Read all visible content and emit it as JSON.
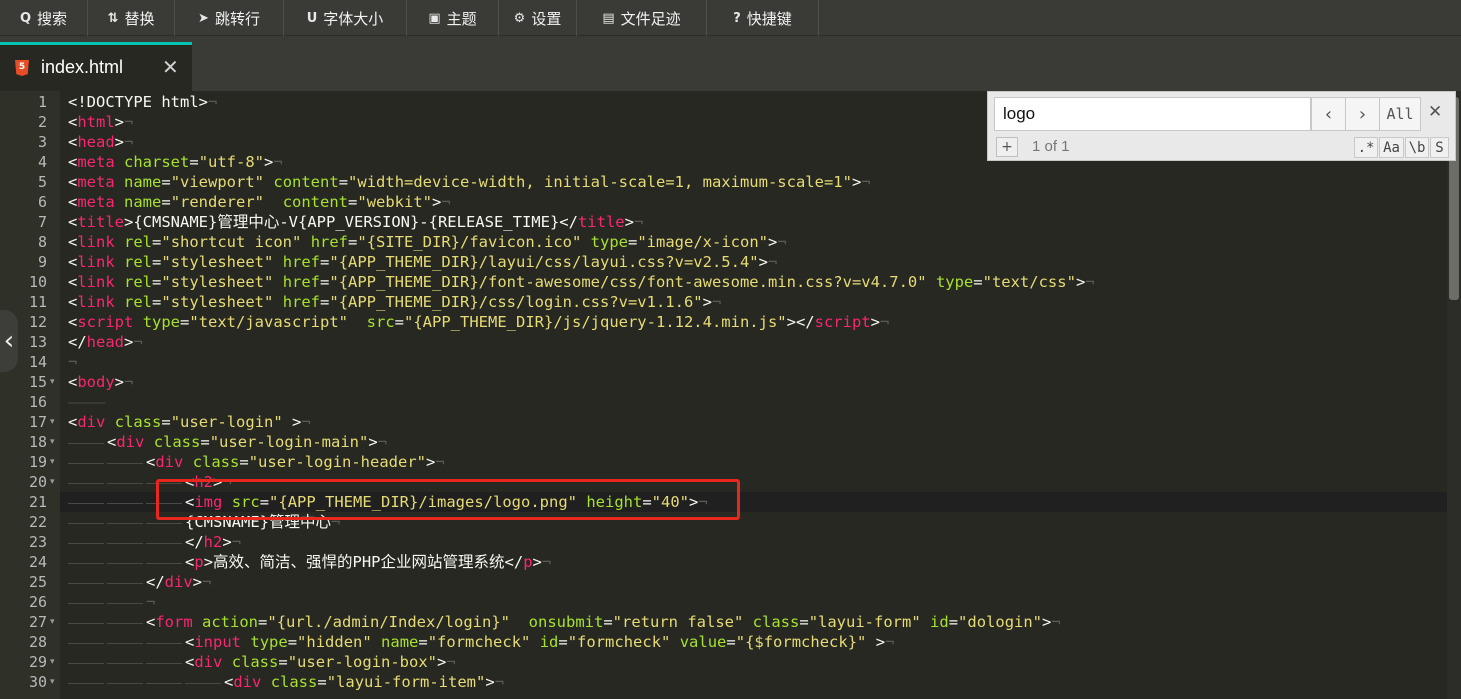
{
  "toolbar": {
    "items": [
      {
        "icon": "search-icon",
        "glyph": "Q",
        "label": "搜索"
      },
      {
        "icon": "replace-icon",
        "glyph": "⇅",
        "label": "替换"
      },
      {
        "icon": "jump-icon",
        "glyph": "➤",
        "label": "跳转行"
      },
      {
        "icon": "font-size-icon",
        "glyph": "U",
        "label": "字体大小"
      },
      {
        "icon": "theme-icon",
        "glyph": "▣",
        "label": "主题"
      },
      {
        "icon": "settings-icon",
        "glyph": "⚙",
        "label": "设置"
      },
      {
        "icon": "history-icon",
        "glyph": "▤",
        "label": "文件足迹"
      },
      {
        "icon": "help-icon",
        "glyph": "?",
        "label": "快捷键"
      }
    ]
  },
  "tab": {
    "icon_text": "5",
    "filename": "index.html",
    "close_glyph": "✕"
  },
  "search": {
    "query": "logo",
    "prev_glyph": "‹",
    "next_glyph": "›",
    "all_label": "All",
    "close_glyph": "✕",
    "plus_glyph": "+",
    "match_count": "1 of 1",
    "regex_label": ".*",
    "case_label": "Aa",
    "word_label": "\\b",
    "selection_label": "S"
  },
  "editor": {
    "active_line": 21,
    "side_handle_glyph": "‹",
    "lines": [
      {
        "n": 1,
        "indent": 0,
        "tokens": [
          [
            "p",
            "<!DOCTYPE html>"
          ],
          [
            "e",
            "¬"
          ]
        ]
      },
      {
        "n": 2,
        "indent": 0,
        "tokens": [
          [
            "p",
            "<"
          ],
          [
            "t",
            "html"
          ],
          [
            "p",
            ">"
          ],
          [
            "e",
            "¬"
          ]
        ]
      },
      {
        "n": 3,
        "indent": 0,
        "tokens": [
          [
            "p",
            "<"
          ],
          [
            "t",
            "head"
          ],
          [
            "p",
            ">"
          ],
          [
            "e",
            "¬"
          ]
        ]
      },
      {
        "n": 4,
        "indent": 0,
        "tokens": [
          [
            "p",
            "<"
          ],
          [
            "t",
            "meta"
          ],
          [
            "p",
            " "
          ],
          [
            "a",
            "charset"
          ],
          [
            "p",
            "="
          ],
          [
            "s",
            "\"utf-8\""
          ],
          [
            "p",
            ">"
          ],
          [
            "e",
            "¬"
          ]
        ]
      },
      {
        "n": 5,
        "indent": 0,
        "tokens": [
          [
            "p",
            "<"
          ],
          [
            "t",
            "meta"
          ],
          [
            "p",
            " "
          ],
          [
            "a",
            "name"
          ],
          [
            "p",
            "="
          ],
          [
            "s",
            "\"viewport\""
          ],
          [
            "p",
            " "
          ],
          [
            "a",
            "content"
          ],
          [
            "p",
            "="
          ],
          [
            "s",
            "\"width=device-width, initial-scale=1, maximum-scale=1\""
          ],
          [
            "p",
            ">"
          ],
          [
            "e",
            "¬"
          ]
        ]
      },
      {
        "n": 6,
        "indent": 0,
        "tokens": [
          [
            "p",
            "<"
          ],
          [
            "t",
            "meta"
          ],
          [
            "p",
            " "
          ],
          [
            "a",
            "name"
          ],
          [
            "p",
            "="
          ],
          [
            "s",
            "\"renderer\""
          ],
          [
            "p",
            "  "
          ],
          [
            "a",
            "content"
          ],
          [
            "p",
            "="
          ],
          [
            "s",
            "\"webkit\""
          ],
          [
            "p",
            ">"
          ],
          [
            "e",
            "¬"
          ]
        ]
      },
      {
        "n": 7,
        "indent": 0,
        "tokens": [
          [
            "p",
            "<"
          ],
          [
            "t",
            "title"
          ],
          [
            "p",
            ">{CMSNAME}管理中心-V{APP_VERSION}-{RELEASE_TIME}</"
          ],
          [
            "t",
            "title"
          ],
          [
            "p",
            ">"
          ],
          [
            "e",
            "¬"
          ]
        ]
      },
      {
        "n": 8,
        "indent": 0,
        "tokens": [
          [
            "p",
            "<"
          ],
          [
            "t",
            "link"
          ],
          [
            "p",
            " "
          ],
          [
            "a",
            "rel"
          ],
          [
            "p",
            "="
          ],
          [
            "s",
            "\"shortcut icon\""
          ],
          [
            "p",
            " "
          ],
          [
            "a",
            "href"
          ],
          [
            "p",
            "="
          ],
          [
            "s",
            "\"{SITE_DIR}/favicon.ico\""
          ],
          [
            "p",
            " "
          ],
          [
            "a",
            "type"
          ],
          [
            "p",
            "="
          ],
          [
            "s",
            "\"image/x-icon\""
          ],
          [
            "p",
            ">"
          ],
          [
            "e",
            "¬"
          ]
        ]
      },
      {
        "n": 9,
        "indent": 0,
        "tokens": [
          [
            "p",
            "<"
          ],
          [
            "t",
            "link"
          ],
          [
            "p",
            " "
          ],
          [
            "a",
            "rel"
          ],
          [
            "p",
            "="
          ],
          [
            "s",
            "\"stylesheet\""
          ],
          [
            "p",
            " "
          ],
          [
            "a",
            "href"
          ],
          [
            "p",
            "="
          ],
          [
            "s",
            "\"{APP_THEME_DIR}/layui/css/layui.css?v=v2.5.4\""
          ],
          [
            "p",
            ">"
          ],
          [
            "e",
            "¬"
          ]
        ]
      },
      {
        "n": 10,
        "indent": 0,
        "tokens": [
          [
            "p",
            "<"
          ],
          [
            "t",
            "link"
          ],
          [
            "p",
            " "
          ],
          [
            "a",
            "rel"
          ],
          [
            "p",
            "="
          ],
          [
            "s",
            "\"stylesheet\""
          ],
          [
            "p",
            " "
          ],
          [
            "a",
            "href"
          ],
          [
            "p",
            "="
          ],
          [
            "s",
            "\"{APP_THEME_DIR}/font-awesome/css/font-awesome.min.css?v=v4.7.0\""
          ],
          [
            "p",
            " "
          ],
          [
            "a",
            "type"
          ],
          [
            "p",
            "="
          ],
          [
            "s",
            "\"text/css\""
          ],
          [
            "p",
            ">"
          ],
          [
            "e",
            "¬"
          ]
        ]
      },
      {
        "n": 11,
        "indent": 0,
        "tokens": [
          [
            "p",
            "<"
          ],
          [
            "t",
            "link"
          ],
          [
            "p",
            " "
          ],
          [
            "a",
            "rel"
          ],
          [
            "p",
            "="
          ],
          [
            "s",
            "\"stylesheet\""
          ],
          [
            "p",
            " "
          ],
          [
            "a",
            "href"
          ],
          [
            "p",
            "="
          ],
          [
            "s",
            "\"{APP_THEME_DIR}/css/login.css?v=v1.1.6\""
          ],
          [
            "p",
            ">"
          ],
          [
            "e",
            "¬"
          ]
        ]
      },
      {
        "n": 12,
        "indent": 0,
        "tokens": [
          [
            "p",
            "<"
          ],
          [
            "t",
            "script"
          ],
          [
            "p",
            " "
          ],
          [
            "a",
            "type"
          ],
          [
            "p",
            "="
          ],
          [
            "s",
            "\"text/javascript\""
          ],
          [
            "p",
            "  "
          ],
          [
            "a",
            "src"
          ],
          [
            "p",
            "="
          ],
          [
            "s",
            "\"{APP_THEME_DIR}/js/jquery-1.12.4.min.js\""
          ],
          [
            "p",
            "></"
          ],
          [
            "t",
            "script"
          ],
          [
            "p",
            ">"
          ],
          [
            "e",
            "¬"
          ]
        ]
      },
      {
        "n": 13,
        "indent": 0,
        "tokens": [
          [
            "p",
            "</"
          ],
          [
            "t",
            "head"
          ],
          [
            "p",
            ">"
          ],
          [
            "e",
            "¬"
          ]
        ]
      },
      {
        "n": 14,
        "indent": 0,
        "tokens": [
          [
            "e",
            "¬"
          ]
        ]
      },
      {
        "n": 15,
        "indent": 0,
        "tokens": [
          [
            "p",
            "<"
          ],
          [
            "t",
            "body"
          ],
          [
            "p",
            ">"
          ],
          [
            "e",
            "¬"
          ]
        ]
      },
      {
        "n": 16,
        "indent": 0,
        "tokens": [
          [
            "i",
            "————"
          ]
        ]
      },
      {
        "n": 17,
        "indent": 0,
        "tokens": [
          [
            "p",
            "<"
          ],
          [
            "t",
            "div"
          ],
          [
            "p",
            " "
          ],
          [
            "a",
            "class"
          ],
          [
            "p",
            "="
          ],
          [
            "s",
            "\"user-login\""
          ],
          [
            "p",
            " >"
          ],
          [
            "e",
            "¬"
          ]
        ]
      },
      {
        "n": 18,
        "indent": 1,
        "tokens": [
          [
            "p",
            "<"
          ],
          [
            "t",
            "div"
          ],
          [
            "p",
            " "
          ],
          [
            "a",
            "class"
          ],
          [
            "p",
            "="
          ],
          [
            "s",
            "\"user-login-main\""
          ],
          [
            "p",
            ">"
          ],
          [
            "e",
            "¬"
          ]
        ]
      },
      {
        "n": 19,
        "indent": 2,
        "tokens": [
          [
            "p",
            "<"
          ],
          [
            "t",
            "div"
          ],
          [
            "p",
            " "
          ],
          [
            "a",
            "class"
          ],
          [
            "p",
            "="
          ],
          [
            "s",
            "\"user-login-header\""
          ],
          [
            "p",
            ">"
          ],
          [
            "e",
            "¬"
          ]
        ]
      },
      {
        "n": 20,
        "indent": 3,
        "tokens": [
          [
            "p",
            "<"
          ],
          [
            "t",
            "h2"
          ],
          [
            "p",
            ">"
          ],
          [
            "e",
            "¬"
          ]
        ]
      },
      {
        "n": 21,
        "indent": 3,
        "tokens": [
          [
            "p",
            "<"
          ],
          [
            "t",
            "img"
          ],
          [
            "p",
            " "
          ],
          [
            "a",
            "src"
          ],
          [
            "p",
            "="
          ],
          [
            "s",
            "\"{APP_THEME_DIR}/images/logo.png\""
          ],
          [
            "p",
            " "
          ],
          [
            "a",
            "height"
          ],
          [
            "p",
            "="
          ],
          [
            "s",
            "\"40\""
          ],
          [
            "p",
            ">"
          ],
          [
            "e",
            "¬"
          ]
        ]
      },
      {
        "n": 22,
        "indent": 3,
        "tokens": [
          [
            "p",
            "{CMSNAME}管理中心"
          ],
          [
            "e",
            "¬"
          ]
        ]
      },
      {
        "n": 23,
        "indent": 3,
        "tokens": [
          [
            "p",
            "</"
          ],
          [
            "t",
            "h2"
          ],
          [
            "p",
            ">"
          ],
          [
            "e",
            "¬"
          ]
        ]
      },
      {
        "n": 24,
        "indent": 3,
        "tokens": [
          [
            "p",
            "<"
          ],
          [
            "t",
            "p"
          ],
          [
            "p",
            ">高效、简洁、强悍的PHP企业网站管理系统</"
          ],
          [
            "t",
            "p"
          ],
          [
            "p",
            ">"
          ],
          [
            "e",
            "¬"
          ]
        ]
      },
      {
        "n": 25,
        "indent": 2,
        "tokens": [
          [
            "p",
            "</"
          ],
          [
            "t",
            "div"
          ],
          [
            "p",
            ">"
          ],
          [
            "e",
            "¬"
          ]
        ]
      },
      {
        "n": 26,
        "indent": 2,
        "tokens": [
          [
            "e",
            "¬"
          ]
        ]
      },
      {
        "n": 27,
        "indent": 2,
        "tokens": [
          [
            "p",
            "<"
          ],
          [
            "t",
            "form"
          ],
          [
            "p",
            " "
          ],
          [
            "a",
            "action"
          ],
          [
            "p",
            "="
          ],
          [
            "s",
            "\"{url./admin/Index/login}\""
          ],
          [
            "p",
            "  "
          ],
          [
            "a",
            "onsubmit"
          ],
          [
            "p",
            "="
          ],
          [
            "s",
            "\"return false\""
          ],
          [
            "p",
            " "
          ],
          [
            "a",
            "class"
          ],
          [
            "p",
            "="
          ],
          [
            "s",
            "\"layui-form\""
          ],
          [
            "p",
            " "
          ],
          [
            "a",
            "id"
          ],
          [
            "p",
            "="
          ],
          [
            "s",
            "\"dologin\""
          ],
          [
            "p",
            ">"
          ],
          [
            "e",
            "¬"
          ]
        ]
      },
      {
        "n": 28,
        "indent": 3,
        "tokens": [
          [
            "p",
            "<"
          ],
          [
            "t",
            "input"
          ],
          [
            "p",
            " "
          ],
          [
            "a",
            "type"
          ],
          [
            "p",
            "="
          ],
          [
            "s",
            "\"hidden\""
          ],
          [
            "p",
            " "
          ],
          [
            "a",
            "name"
          ],
          [
            "p",
            "="
          ],
          [
            "s",
            "\"formcheck\""
          ],
          [
            "p",
            " "
          ],
          [
            "a",
            "id"
          ],
          [
            "p",
            "="
          ],
          [
            "s",
            "\"formcheck\""
          ],
          [
            "p",
            " "
          ],
          [
            "a",
            "value"
          ],
          [
            "p",
            "="
          ],
          [
            "s",
            "\"{$formcheck}\""
          ],
          [
            "p",
            " >"
          ],
          [
            "e",
            "¬"
          ]
        ]
      },
      {
        "n": 29,
        "indent": 3,
        "tokens": [
          [
            "p",
            "<"
          ],
          [
            "t",
            "div"
          ],
          [
            "p",
            " "
          ],
          [
            "a",
            "class"
          ],
          [
            "p",
            "="
          ],
          [
            "s",
            "\"user-login-box\""
          ],
          [
            "p",
            ">"
          ],
          [
            "e",
            "¬"
          ]
        ]
      },
      {
        "n": 30,
        "indent": 4,
        "tokens": [
          [
            "p",
            "<"
          ],
          [
            "t",
            "div"
          ],
          [
            "p",
            " "
          ],
          [
            "a",
            "class"
          ],
          [
            "p",
            "="
          ],
          [
            "s",
            "\"layui-form-item\""
          ],
          [
            "p",
            ">"
          ],
          [
            "e",
            "¬"
          ]
        ]
      }
    ]
  }
}
